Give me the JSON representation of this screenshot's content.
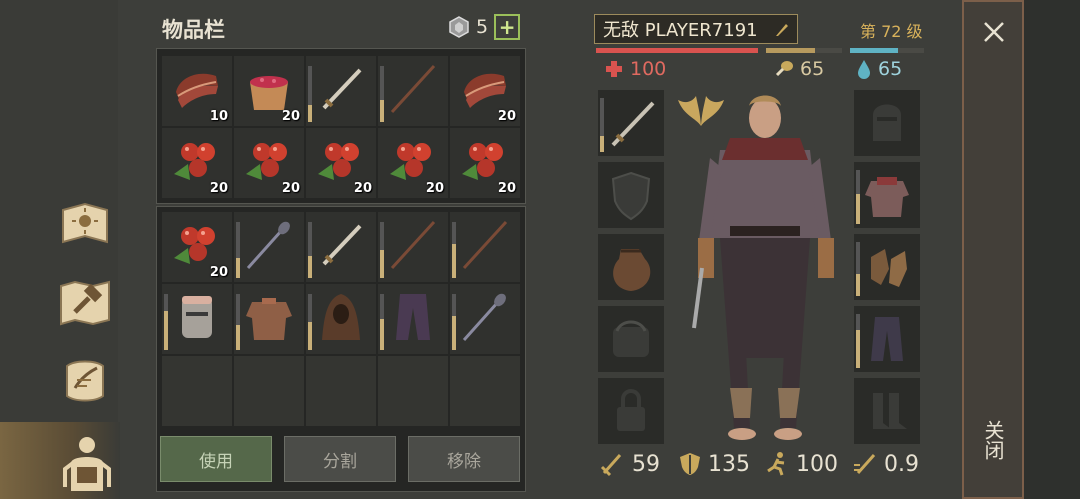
{
  "inventory": {
    "title": "物品栏",
    "currency_count": "5",
    "plus_label": "+",
    "slots_main": [
      {
        "icon": "meat-icon",
        "qty": "10",
        "dura": null
      },
      {
        "icon": "berry-bowl-icon",
        "qty": "20",
        "dura": null
      },
      {
        "icon": "sword-icon",
        "qty": "",
        "dura": 0.3
      },
      {
        "icon": "spear-icon",
        "qty": "",
        "dura": 0.4
      },
      {
        "icon": "meat-icon",
        "qty": "20",
        "dura": null
      },
      {
        "icon": "berries-icon",
        "qty": "20",
        "dura": null
      },
      {
        "icon": "berries-icon",
        "qty": "20",
        "dura": null
      },
      {
        "icon": "berries-icon",
        "qty": "20",
        "dura": null
      },
      {
        "icon": "berries-icon",
        "qty": "20",
        "dura": null
      },
      {
        "icon": "berries-icon",
        "qty": "20",
        "dura": null
      }
    ],
    "slots_bag": [
      {
        "icon": "berries-icon",
        "qty": "20",
        "dura": null
      },
      {
        "icon": "mace-spear-icon",
        "qty": "",
        "dura": 0.35
      },
      {
        "icon": "sword-icon",
        "qty": "",
        "dura": 0.4
      },
      {
        "icon": "spear-icon",
        "qty": "",
        "dura": 0.5
      },
      {
        "icon": "spear-icon",
        "qty": "",
        "dura": 0.6
      },
      {
        "icon": "helmet-icon",
        "qty": "",
        "dura": 0.7
      },
      {
        "icon": "chainmail-icon",
        "qty": "",
        "dura": 0.45
      },
      {
        "icon": "hood-icon",
        "qty": "",
        "dura": 0.5
      },
      {
        "icon": "pants-icon",
        "qty": "",
        "dura": 0.55
      },
      {
        "icon": "mace-spear-icon",
        "qty": "",
        "dura": 0.6
      },
      {
        "icon": "",
        "qty": "",
        "dura": null
      },
      {
        "icon": "",
        "qty": "",
        "dura": null
      },
      {
        "icon": "",
        "qty": "",
        "dura": null
      },
      {
        "icon": "",
        "qty": "",
        "dura": null
      },
      {
        "icon": "",
        "qty": "",
        "dura": null
      }
    ],
    "buttons": {
      "use": "使用",
      "split": "分割",
      "remove": "移除"
    }
  },
  "character": {
    "name": "无敌 PLAYER7191",
    "level": "第 72 级",
    "health": "100",
    "hunger": "65",
    "thirst": "65",
    "health_fill": 1.0,
    "hunger_fill": 0.65,
    "thirst_fill": 0.65,
    "colors": {
      "health": "#d9534f",
      "hunger": "#b79a5e",
      "thirst": "#5fb3c4"
    },
    "bottom_stats": {
      "attack": "59",
      "defense": "135",
      "speed": "100",
      "attack_speed": "0.9"
    }
  },
  "close": {
    "label": "关闭"
  }
}
